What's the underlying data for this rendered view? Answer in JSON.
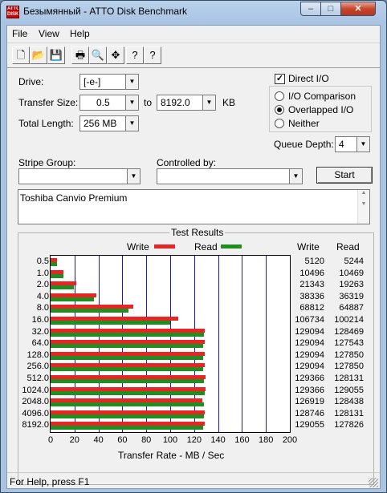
{
  "window": {
    "title": "Безымянный - ATTO Disk Benchmark",
    "icon_text": "ATTO DISK",
    "caption": {
      "minimize": "–",
      "maximize": "□",
      "close": "✕"
    }
  },
  "menu": [
    {
      "label": "File"
    },
    {
      "label": "View"
    },
    {
      "label": "Help"
    }
  ],
  "toolbar": [
    "new-icon",
    "open-icon",
    "save-icon",
    "print-icon",
    "print-preview-icon",
    "move-icon",
    "help-icon",
    "context-help-icon"
  ],
  "toolbar_glyphs": [
    "🗋",
    "📂",
    "💾",
    "🖶",
    "🔍",
    "✥",
    "?",
    "?"
  ],
  "form": {
    "drive_label": "Drive:",
    "drive_value": "[-e-]",
    "transfer_size_label": "Transfer Size:",
    "transfer_from": "0.5",
    "to_label": "to",
    "transfer_to": "8192.0",
    "kb_label": "KB",
    "total_length_label": "Total Length:",
    "total_length_value": "256 MB",
    "direct_io_label": "Direct I/O",
    "io_comparison_label": "I/O Comparison",
    "overlapped_io_label": "Overlapped I/O",
    "neither_label": "Neither",
    "queue_depth_label": "Queue Depth:",
    "queue_depth_value": "4",
    "stripe_group_label": "Stripe Group:",
    "stripe_group_value": "",
    "controlled_by_label": "Controlled by:",
    "controlled_by_value": "",
    "start_label": "Start",
    "description": "Toshiba Canvio Premium"
  },
  "results": {
    "title": "Test Results",
    "write_legend": "Write",
    "read_legend": "Read",
    "write_col": "Write",
    "read_col": "Read",
    "xlabel": "Transfer Rate - MB / Sec"
  },
  "chart_data": {
    "type": "bar",
    "orientation": "horizontal",
    "title": "Test Results",
    "xlabel": "Transfer Rate - MB / Sec",
    "xlim": [
      0,
      200
    ],
    "xticks": [
      0,
      20,
      40,
      60,
      80,
      100,
      120,
      140,
      160,
      180,
      200
    ],
    "categories": [
      "0.5",
      "1.0",
      "2.0",
      "4.0",
      "8.0",
      "16.0",
      "32.0",
      "64.0",
      "128.0",
      "256.0",
      "512.0",
      "1024.0",
      "2048.0",
      "4096.0",
      "8192.0"
    ],
    "series": [
      {
        "name": "Write",
        "color": "#e82424",
        "values": [
          5120,
          10496,
          21343,
          38336,
          68812,
          106734,
          129094,
          129094,
          129094,
          129094,
          129366,
          129366,
          126919,
          128746,
          129055
        ]
      },
      {
        "name": "Read",
        "color": "#1f8f1f",
        "values": [
          5244,
          10469,
          19263,
          36319,
          64887,
          100214,
          128469,
          127543,
          127850,
          127850,
          128131,
          129055,
          128438,
          128131,
          127826
        ]
      }
    ]
  },
  "status": {
    "text": "For Help, press F1"
  }
}
